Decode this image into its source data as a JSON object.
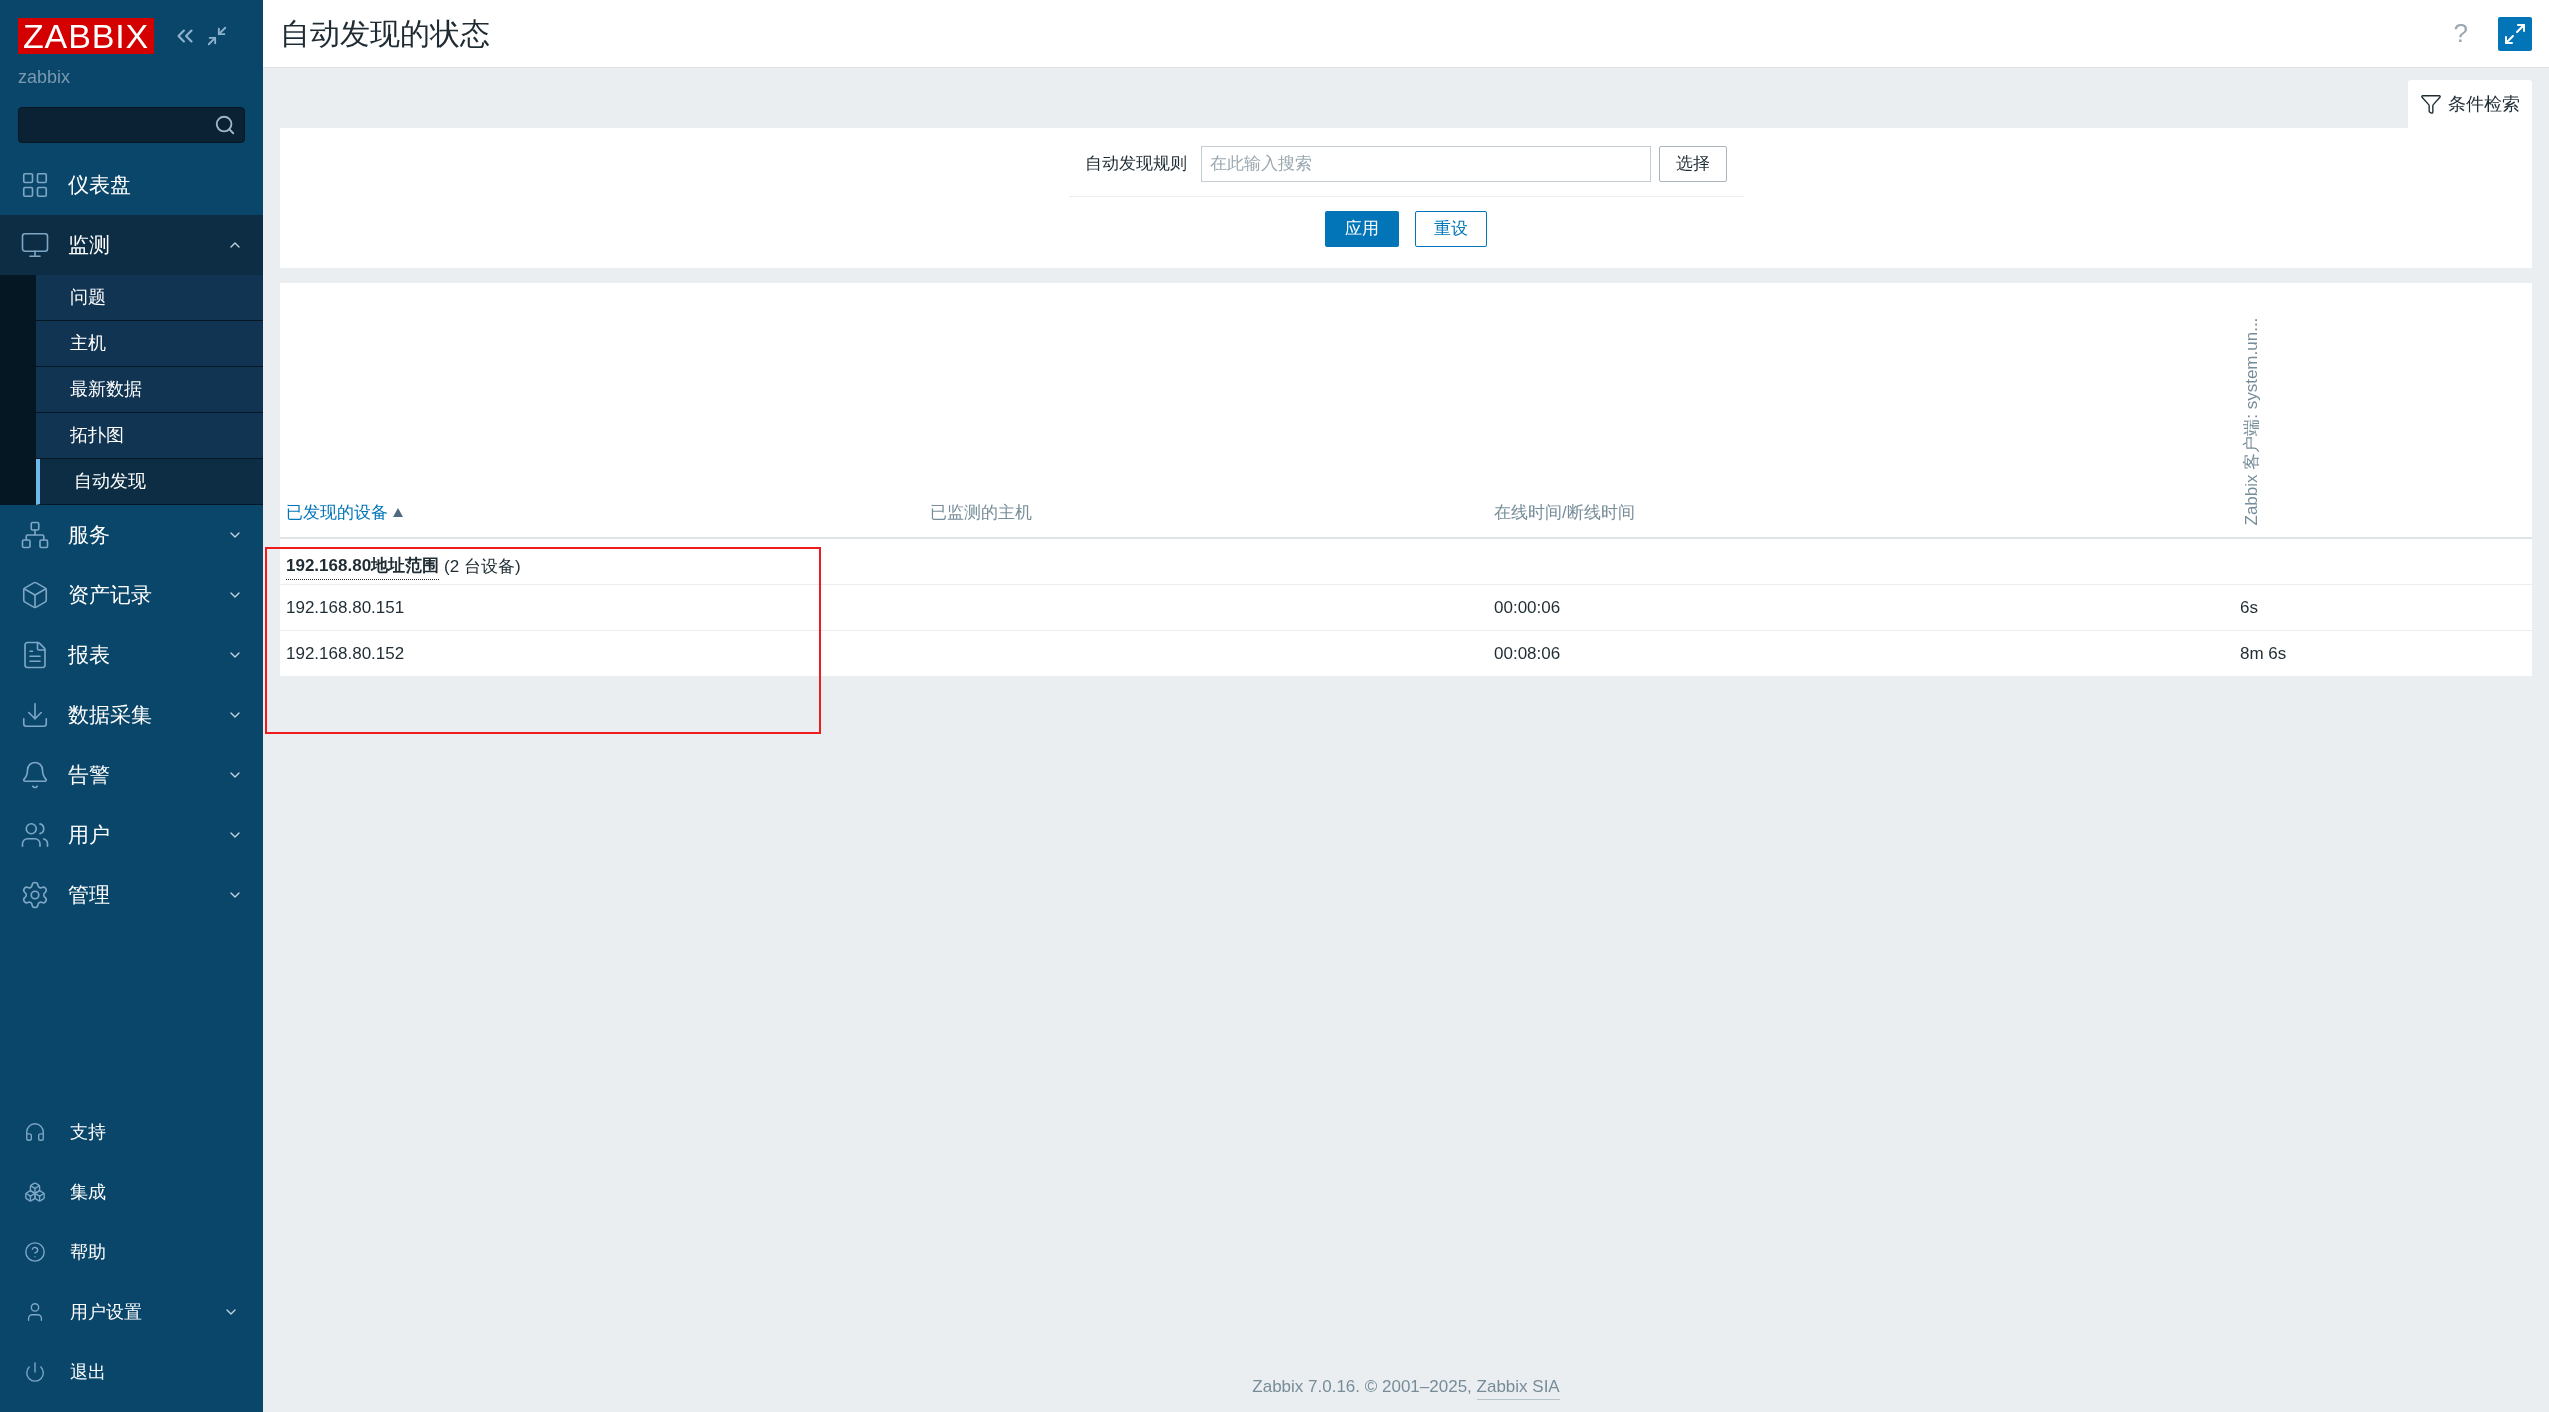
{
  "sidebar": {
    "logo": "ZABBIX",
    "server": "zabbix",
    "menu": [
      {
        "label": "仪表盘"
      },
      {
        "label": "监测",
        "expanded": true,
        "children": [
          {
            "label": "问题",
            "selected": false
          },
          {
            "label": "主机",
            "selected": false
          },
          {
            "label": "最新数据",
            "selected": false
          },
          {
            "label": "拓扑图",
            "selected": false
          },
          {
            "label": "自动发现",
            "selected": true
          }
        ]
      },
      {
        "label": "服务",
        "expanded": false
      },
      {
        "label": "资产记录",
        "expanded": false
      },
      {
        "label": "报表",
        "expanded": false
      },
      {
        "label": "数据采集",
        "expanded": false
      },
      {
        "label": "告警",
        "expanded": false
      },
      {
        "label": "用户",
        "expanded": false
      },
      {
        "label": "管理",
        "expanded": false
      }
    ],
    "bottom_menu": [
      {
        "label": "支持"
      },
      {
        "label": "集成"
      },
      {
        "label": "帮助"
      },
      {
        "label": "用户设置",
        "expanded": false
      },
      {
        "label": "退出"
      }
    ]
  },
  "header": {
    "title": "自动发现的状态",
    "help": "?"
  },
  "filter": {
    "tab": "条件检索",
    "label": "自动发现规则",
    "placeholder": "在此输入搜索",
    "select_button": "选择",
    "apply_button": "应用",
    "reset_button": "重设"
  },
  "table": {
    "columns": [
      {
        "kind": "sortable",
        "label": "已发现的设备",
        "sorted_ascending": true
      },
      {
        "kind": "plain",
        "label": "已监测的主机"
      },
      {
        "kind": "plain",
        "label": "在线时间/断线时间"
      },
      {
        "kind": "vertical",
        "label": "Zabbix 客户端: system.un..."
      }
    ],
    "rows": [
      {
        "kind": "group",
        "name": "192.168.80地址范围",
        "count": "(2 台设备)"
      },
      {
        "kind": "device",
        "cells": [
          "192.168.80.151",
          "",
          "00:00:06",
          "6s"
        ]
      },
      {
        "kind": "device",
        "cells": [
          "192.168.80.152",
          "",
          "00:08:06",
          "8m 6s"
        ]
      }
    ]
  },
  "footer": {
    "text": "Zabbix 7.0.16. © 2001–2025, ",
    "link": "Zabbix SIA"
  }
}
